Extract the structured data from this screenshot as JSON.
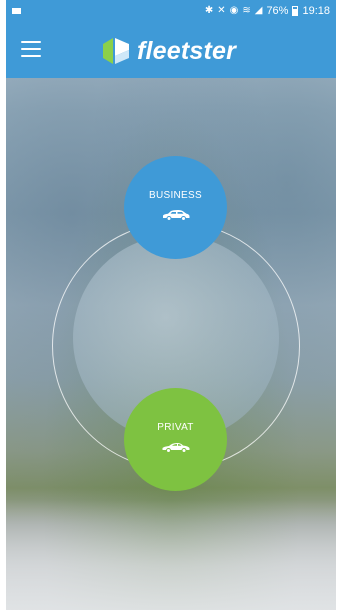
{
  "status_bar": {
    "battery": "76%",
    "time": "19:18",
    "icons": [
      "mail-icon",
      "bluetooth-icon",
      "mute-icon",
      "alarm-icon",
      "wifi-icon",
      "signal-icon",
      "battery-icon"
    ]
  },
  "app_bar": {
    "title": "fleetster",
    "menu_icon": "hamburger-menu-icon",
    "colors": {
      "primary": "#3f9ad7"
    }
  },
  "modes": {
    "business": {
      "label": "BUSINESS",
      "icon": "sedan-car-icon",
      "color": "#3f9ad7"
    },
    "privat": {
      "label": "PRIVAT",
      "icon": "sports-car-icon",
      "color": "#7ec241"
    }
  }
}
